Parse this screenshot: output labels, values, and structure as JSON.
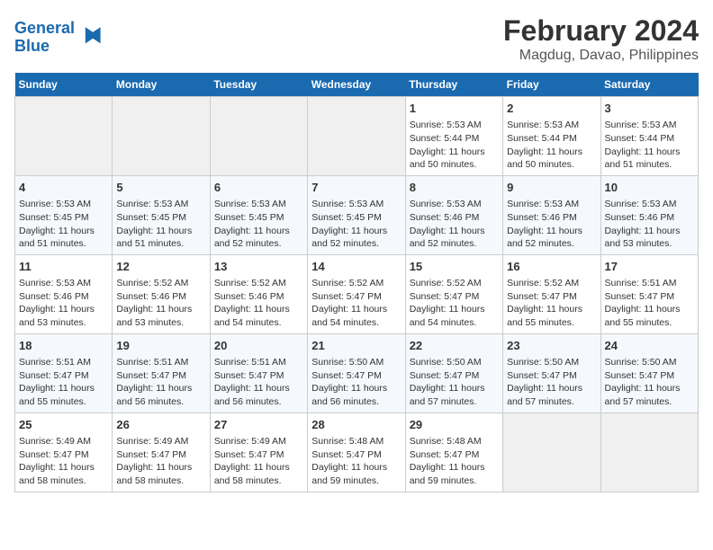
{
  "header": {
    "title": "February 2024",
    "subtitle": "Magdug, Davao, Philippines",
    "logo_line1": "General",
    "logo_line2": "Blue"
  },
  "columns": [
    "Sunday",
    "Monday",
    "Tuesday",
    "Wednesday",
    "Thursday",
    "Friday",
    "Saturday"
  ],
  "weeks": [
    [
      {
        "day": "",
        "detail": ""
      },
      {
        "day": "",
        "detail": ""
      },
      {
        "day": "",
        "detail": ""
      },
      {
        "day": "",
        "detail": ""
      },
      {
        "day": "1",
        "detail": "Sunrise: 5:53 AM\nSunset: 5:44 PM\nDaylight: 11 hours and 50 minutes."
      },
      {
        "day": "2",
        "detail": "Sunrise: 5:53 AM\nSunset: 5:44 PM\nDaylight: 11 hours and 50 minutes."
      },
      {
        "day": "3",
        "detail": "Sunrise: 5:53 AM\nSunset: 5:44 PM\nDaylight: 11 hours and 51 minutes."
      }
    ],
    [
      {
        "day": "4",
        "detail": "Sunrise: 5:53 AM\nSunset: 5:45 PM\nDaylight: 11 hours and 51 minutes."
      },
      {
        "day": "5",
        "detail": "Sunrise: 5:53 AM\nSunset: 5:45 PM\nDaylight: 11 hours and 51 minutes."
      },
      {
        "day": "6",
        "detail": "Sunrise: 5:53 AM\nSunset: 5:45 PM\nDaylight: 11 hours and 52 minutes."
      },
      {
        "day": "7",
        "detail": "Sunrise: 5:53 AM\nSunset: 5:45 PM\nDaylight: 11 hours and 52 minutes."
      },
      {
        "day": "8",
        "detail": "Sunrise: 5:53 AM\nSunset: 5:46 PM\nDaylight: 11 hours and 52 minutes."
      },
      {
        "day": "9",
        "detail": "Sunrise: 5:53 AM\nSunset: 5:46 PM\nDaylight: 11 hours and 52 minutes."
      },
      {
        "day": "10",
        "detail": "Sunrise: 5:53 AM\nSunset: 5:46 PM\nDaylight: 11 hours and 53 minutes."
      }
    ],
    [
      {
        "day": "11",
        "detail": "Sunrise: 5:53 AM\nSunset: 5:46 PM\nDaylight: 11 hours and 53 minutes."
      },
      {
        "day": "12",
        "detail": "Sunrise: 5:52 AM\nSunset: 5:46 PM\nDaylight: 11 hours and 53 minutes."
      },
      {
        "day": "13",
        "detail": "Sunrise: 5:52 AM\nSunset: 5:46 PM\nDaylight: 11 hours and 54 minutes."
      },
      {
        "day": "14",
        "detail": "Sunrise: 5:52 AM\nSunset: 5:47 PM\nDaylight: 11 hours and 54 minutes."
      },
      {
        "day": "15",
        "detail": "Sunrise: 5:52 AM\nSunset: 5:47 PM\nDaylight: 11 hours and 54 minutes."
      },
      {
        "day": "16",
        "detail": "Sunrise: 5:52 AM\nSunset: 5:47 PM\nDaylight: 11 hours and 55 minutes."
      },
      {
        "day": "17",
        "detail": "Sunrise: 5:51 AM\nSunset: 5:47 PM\nDaylight: 11 hours and 55 minutes."
      }
    ],
    [
      {
        "day": "18",
        "detail": "Sunrise: 5:51 AM\nSunset: 5:47 PM\nDaylight: 11 hours and 55 minutes."
      },
      {
        "day": "19",
        "detail": "Sunrise: 5:51 AM\nSunset: 5:47 PM\nDaylight: 11 hours and 56 minutes."
      },
      {
        "day": "20",
        "detail": "Sunrise: 5:51 AM\nSunset: 5:47 PM\nDaylight: 11 hours and 56 minutes."
      },
      {
        "day": "21",
        "detail": "Sunrise: 5:50 AM\nSunset: 5:47 PM\nDaylight: 11 hours and 56 minutes."
      },
      {
        "day": "22",
        "detail": "Sunrise: 5:50 AM\nSunset: 5:47 PM\nDaylight: 11 hours and 57 minutes."
      },
      {
        "day": "23",
        "detail": "Sunrise: 5:50 AM\nSunset: 5:47 PM\nDaylight: 11 hours and 57 minutes."
      },
      {
        "day": "24",
        "detail": "Sunrise: 5:50 AM\nSunset: 5:47 PM\nDaylight: 11 hours and 57 minutes."
      }
    ],
    [
      {
        "day": "25",
        "detail": "Sunrise: 5:49 AM\nSunset: 5:47 PM\nDaylight: 11 hours and 58 minutes."
      },
      {
        "day": "26",
        "detail": "Sunrise: 5:49 AM\nSunset: 5:47 PM\nDaylight: 11 hours and 58 minutes."
      },
      {
        "day": "27",
        "detail": "Sunrise: 5:49 AM\nSunset: 5:47 PM\nDaylight: 11 hours and 58 minutes."
      },
      {
        "day": "28",
        "detail": "Sunrise: 5:48 AM\nSunset: 5:47 PM\nDaylight: 11 hours and 59 minutes."
      },
      {
        "day": "29",
        "detail": "Sunrise: 5:48 AM\nSunset: 5:47 PM\nDaylight: 11 hours and 59 minutes."
      },
      {
        "day": "",
        "detail": ""
      },
      {
        "day": "",
        "detail": ""
      }
    ]
  ]
}
